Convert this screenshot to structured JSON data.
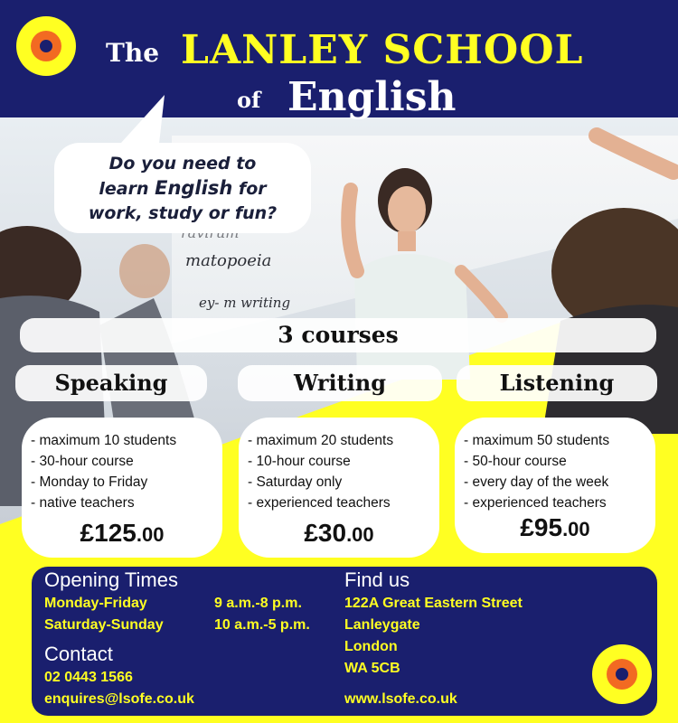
{
  "header": {
    "title_the": "The",
    "title_school": "LANLEY SCHOOL",
    "title_of": "of",
    "title_english": "English"
  },
  "photo_board": {
    "line1": "ravirum",
    "line2": "matopoeia",
    "line3": "ey- m writing"
  },
  "bubble": {
    "line1": "Do you need to",
    "line2_pre": "learn",
    "line2_em": "English",
    "line2_post": "for",
    "line3": "work, study or fun?"
  },
  "courses": {
    "heading": "3 courses",
    "items": [
      {
        "name": "Speaking",
        "details": [
          "- maximum 10 students",
          "- 30-hour course",
          "- Monday to Friday",
          "- native teachers"
        ],
        "price_main": "£125",
        "price_pence": ".00"
      },
      {
        "name": "Writing",
        "details": [
          "- maximum 20 students",
          "- 10-hour course",
          "- Saturday only",
          "- experienced teachers"
        ],
        "price_main": "£30",
        "price_pence": ".00"
      },
      {
        "name": "Listening",
        "details": [
          "- maximum 50 students",
          "- 50-hour course",
          "- every day of the week",
          "- experienced teachers"
        ],
        "price_main": "£95",
        "price_pence": ".00"
      }
    ]
  },
  "info": {
    "opening_heading": "Opening Times",
    "opening": [
      {
        "days": "Monday-Friday",
        "hours": "9 a.m.-8 p.m."
      },
      {
        "days": "Saturday-Sunday",
        "hours": "10 a.m.-5 p.m."
      }
    ],
    "contact_heading": "Contact",
    "phone": "02 0443 1566",
    "email": "enquires@lsofe.co.uk",
    "find_heading": "Find us",
    "address": [
      "122A Great Eastern Street",
      "Lanleygate",
      "London",
      "WA 5CB"
    ],
    "website": "www.lsofe.co.uk"
  },
  "colors": {
    "navy": "#1a1f6e",
    "yellow": "#ffff22",
    "orange": "#f26a22"
  }
}
